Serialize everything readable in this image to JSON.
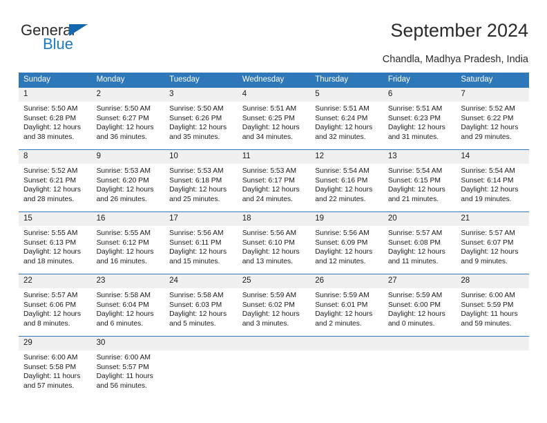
{
  "logo": {
    "word1": "General",
    "word2": "Blue",
    "triangle_color": "#1267ae",
    "word2_color": "#1b7ac4"
  },
  "header": {
    "title": "September 2024",
    "subtitle": "Chandla, Madhya Pradesh, India",
    "accent_color": "#2e77b8",
    "daynum_band_color": "#f0f0f0"
  },
  "weekdays": [
    "Sunday",
    "Monday",
    "Tuesday",
    "Wednesday",
    "Thursday",
    "Friday",
    "Saturday"
  ],
  "weeks": [
    [
      {
        "day": "1",
        "sunrise": "Sunrise: 5:50 AM",
        "sunset": "Sunset: 6:28 PM",
        "daylight": "Daylight: 12 hours and 38 minutes."
      },
      {
        "day": "2",
        "sunrise": "Sunrise: 5:50 AM",
        "sunset": "Sunset: 6:27 PM",
        "daylight": "Daylight: 12 hours and 36 minutes."
      },
      {
        "day": "3",
        "sunrise": "Sunrise: 5:50 AM",
        "sunset": "Sunset: 6:26 PM",
        "daylight": "Daylight: 12 hours and 35 minutes."
      },
      {
        "day": "4",
        "sunrise": "Sunrise: 5:51 AM",
        "sunset": "Sunset: 6:25 PM",
        "daylight": "Daylight: 12 hours and 34 minutes."
      },
      {
        "day": "5",
        "sunrise": "Sunrise: 5:51 AM",
        "sunset": "Sunset: 6:24 PM",
        "daylight": "Daylight: 12 hours and 32 minutes."
      },
      {
        "day": "6",
        "sunrise": "Sunrise: 5:51 AM",
        "sunset": "Sunset: 6:23 PM",
        "daylight": "Daylight: 12 hours and 31 minutes."
      },
      {
        "day": "7",
        "sunrise": "Sunrise: 5:52 AM",
        "sunset": "Sunset: 6:22 PM",
        "daylight": "Daylight: 12 hours and 29 minutes."
      }
    ],
    [
      {
        "day": "8",
        "sunrise": "Sunrise: 5:52 AM",
        "sunset": "Sunset: 6:21 PM",
        "daylight": "Daylight: 12 hours and 28 minutes."
      },
      {
        "day": "9",
        "sunrise": "Sunrise: 5:53 AM",
        "sunset": "Sunset: 6:20 PM",
        "daylight": "Daylight: 12 hours and 26 minutes."
      },
      {
        "day": "10",
        "sunrise": "Sunrise: 5:53 AM",
        "sunset": "Sunset: 6:18 PM",
        "daylight": "Daylight: 12 hours and 25 minutes."
      },
      {
        "day": "11",
        "sunrise": "Sunrise: 5:53 AM",
        "sunset": "Sunset: 6:17 PM",
        "daylight": "Daylight: 12 hours and 24 minutes."
      },
      {
        "day": "12",
        "sunrise": "Sunrise: 5:54 AM",
        "sunset": "Sunset: 6:16 PM",
        "daylight": "Daylight: 12 hours and 22 minutes."
      },
      {
        "day": "13",
        "sunrise": "Sunrise: 5:54 AM",
        "sunset": "Sunset: 6:15 PM",
        "daylight": "Daylight: 12 hours and 21 minutes."
      },
      {
        "day": "14",
        "sunrise": "Sunrise: 5:54 AM",
        "sunset": "Sunset: 6:14 PM",
        "daylight": "Daylight: 12 hours and 19 minutes."
      }
    ],
    [
      {
        "day": "15",
        "sunrise": "Sunrise: 5:55 AM",
        "sunset": "Sunset: 6:13 PM",
        "daylight": "Daylight: 12 hours and 18 minutes."
      },
      {
        "day": "16",
        "sunrise": "Sunrise: 5:55 AM",
        "sunset": "Sunset: 6:12 PM",
        "daylight": "Daylight: 12 hours and 16 minutes."
      },
      {
        "day": "17",
        "sunrise": "Sunrise: 5:56 AM",
        "sunset": "Sunset: 6:11 PM",
        "daylight": "Daylight: 12 hours and 15 minutes."
      },
      {
        "day": "18",
        "sunrise": "Sunrise: 5:56 AM",
        "sunset": "Sunset: 6:10 PM",
        "daylight": "Daylight: 12 hours and 13 minutes."
      },
      {
        "day": "19",
        "sunrise": "Sunrise: 5:56 AM",
        "sunset": "Sunset: 6:09 PM",
        "daylight": "Daylight: 12 hours and 12 minutes."
      },
      {
        "day": "20",
        "sunrise": "Sunrise: 5:57 AM",
        "sunset": "Sunset: 6:08 PM",
        "daylight": "Daylight: 12 hours and 11 minutes."
      },
      {
        "day": "21",
        "sunrise": "Sunrise: 5:57 AM",
        "sunset": "Sunset: 6:07 PM",
        "daylight": "Daylight: 12 hours and 9 minutes."
      }
    ],
    [
      {
        "day": "22",
        "sunrise": "Sunrise: 5:57 AM",
        "sunset": "Sunset: 6:06 PM",
        "daylight": "Daylight: 12 hours and 8 minutes."
      },
      {
        "day": "23",
        "sunrise": "Sunrise: 5:58 AM",
        "sunset": "Sunset: 6:04 PM",
        "daylight": "Daylight: 12 hours and 6 minutes."
      },
      {
        "day": "24",
        "sunrise": "Sunrise: 5:58 AM",
        "sunset": "Sunset: 6:03 PM",
        "daylight": "Daylight: 12 hours and 5 minutes."
      },
      {
        "day": "25",
        "sunrise": "Sunrise: 5:59 AM",
        "sunset": "Sunset: 6:02 PM",
        "daylight": "Daylight: 12 hours and 3 minutes."
      },
      {
        "day": "26",
        "sunrise": "Sunrise: 5:59 AM",
        "sunset": "Sunset: 6:01 PM",
        "daylight": "Daylight: 12 hours and 2 minutes."
      },
      {
        "day": "27",
        "sunrise": "Sunrise: 5:59 AM",
        "sunset": "Sunset: 6:00 PM",
        "daylight": "Daylight: 12 hours and 0 minutes."
      },
      {
        "day": "28",
        "sunrise": "Sunrise: 6:00 AM",
        "sunset": "Sunset: 5:59 PM",
        "daylight": "Daylight: 11 hours and 59 minutes."
      }
    ],
    [
      {
        "day": "29",
        "sunrise": "Sunrise: 6:00 AM",
        "sunset": "Sunset: 5:58 PM",
        "daylight": "Daylight: 11 hours and 57 minutes."
      },
      {
        "day": "30",
        "sunrise": "Sunrise: 6:00 AM",
        "sunset": "Sunset: 5:57 PM",
        "daylight": "Daylight: 11 hours and 56 minutes."
      },
      {
        "day": "",
        "sunrise": "",
        "sunset": "",
        "daylight": ""
      },
      {
        "day": "",
        "sunrise": "",
        "sunset": "",
        "daylight": ""
      },
      {
        "day": "",
        "sunrise": "",
        "sunset": "",
        "daylight": ""
      },
      {
        "day": "",
        "sunrise": "",
        "sunset": "",
        "daylight": ""
      },
      {
        "day": "",
        "sunrise": "",
        "sunset": "",
        "daylight": ""
      }
    ]
  ]
}
